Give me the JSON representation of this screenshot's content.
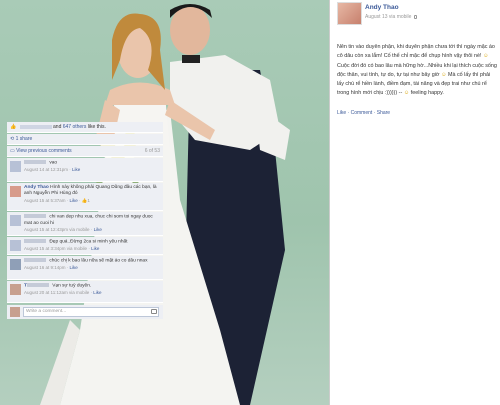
{
  "post": {
    "author": "Andy Thao",
    "date": "August 13",
    "via": "via mobile",
    "status_text": "Nên tin vào duyên phận, khi duyên phận chưa tới thì ngày mặc áo cô dâu còn xa lắm! Cố thể chỉ mặc để chụp hình vậy thôi nè!",
    "status_text_2": "Cuộc đời đó có bao lâu mà hững hờ...Nhiều khi lại thích cuộc sống độc thân, vui tính, tự do, tự tại như bây giờ",
    "status_text_3": "Mà cố lấy thì phải lấy chú rể hiền lành, điềm đạm, tài năng và đẹp trai như chú rể trong hình mới chịu :)))))) --",
    "feeling": "feeling happy.",
    "actions": "Like · Comment · Share",
    "likes_others": "647 others",
    "likes_suffix": "like this.",
    "shares": "1 share",
    "view_previous": "View previous comments",
    "comment_count": "6 of 53"
  },
  "comments": [
    {
      "name": "",
      "text": "vao",
      "time": "August 14 at 12:31pm",
      "action": "Like"
    },
    {
      "name": "Andy Thao",
      "text": "Hình này không phải Quang Dũng đâu các bạn, là anh Nguyễn Phi Hùng đó",
      "time": "August 15 at 5:37am",
      "action": "Like",
      "likes": "1"
    },
    {
      "name": "",
      "text": "chi van dep nhu xua, chuc chi som toi ngay duoc mat ao cuoi hi",
      "time": "August 15 at 12:43pm",
      "action": "via mobile",
      "extra": "Like"
    },
    {
      "name": "",
      "text": "Đẹp quá..Đừng 2ca si minh yêu nhất",
      "time": "August 15 at 3:34pm",
      "action": "via mobile",
      "extra": "Like"
    },
    {
      "name": "",
      "text": "chúc chị k bao lâu nữa sẽ mặt áo co dâu nnax",
      "time": "August 16 at 9:14pm",
      "action": "Like"
    },
    {
      "name": "T",
      "text": "Vạn sự tuỳ duyên.",
      "time": "August 20 at 11:12am",
      "action": "via mobile",
      "extra": "Like"
    }
  ],
  "write_comment": {
    "placeholder": "Write a comment..."
  },
  "colors": {
    "link": "#3b5998",
    "box": "#edeff4"
  }
}
